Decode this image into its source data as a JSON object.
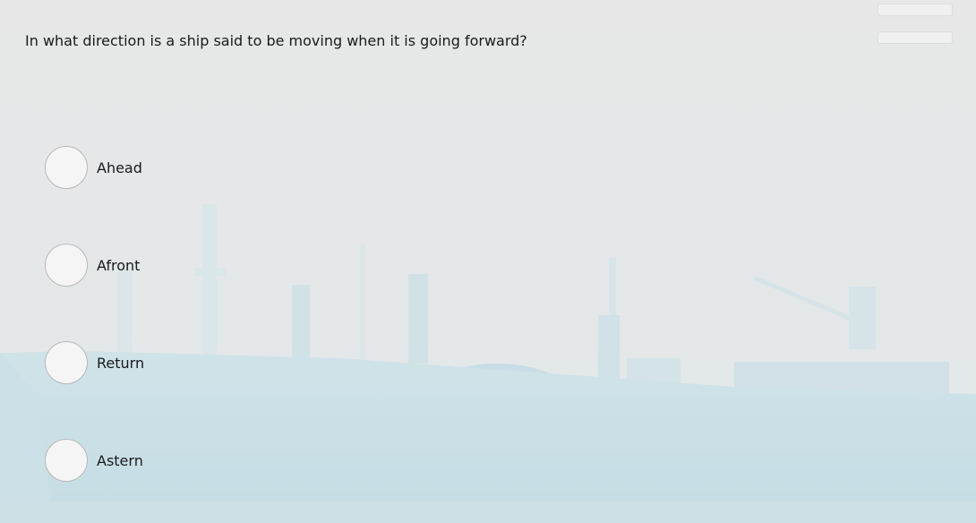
{
  "question": {
    "text": "In what direction is a ship said to be moving when it is going forward?"
  },
  "options": [
    {
      "label": "Ahead"
    },
    {
      "label": "Afront"
    },
    {
      "label": "Return"
    },
    {
      "label": "Astern"
    }
  ],
  "background": {
    "image": "ship-in-port-photo",
    "tint": "#cfe3ea"
  }
}
